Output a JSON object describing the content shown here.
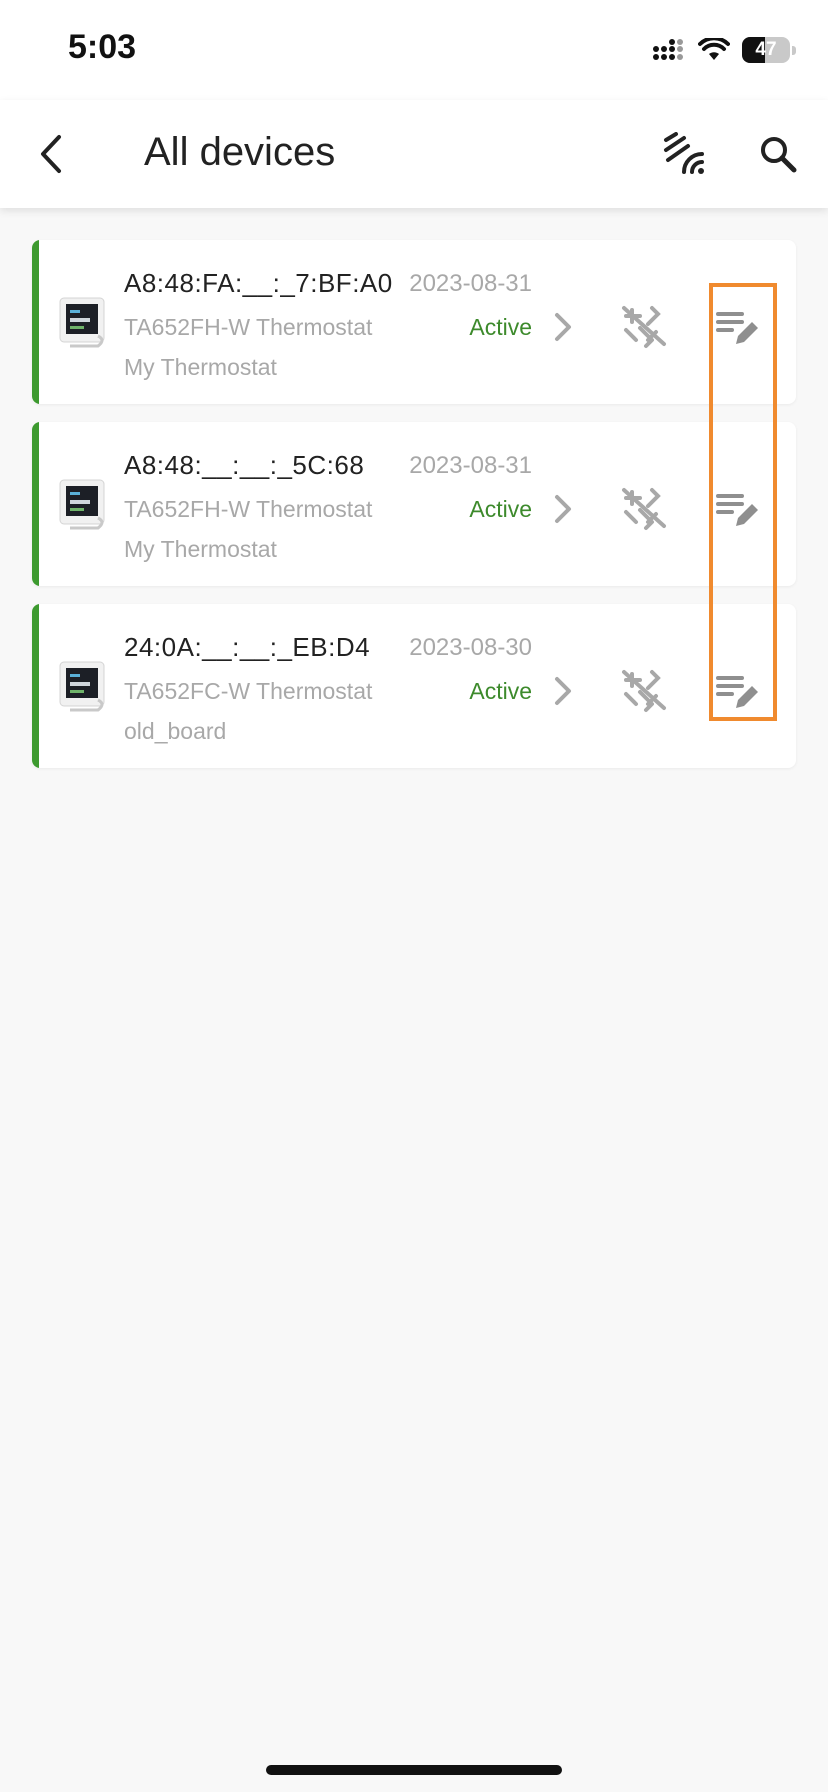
{
  "status_bar": {
    "time": "5:03",
    "battery_level": "47",
    "battery_fraction": 0.47
  },
  "app_bar": {
    "title": "All devices",
    "back_icon": "chevron-left-icon",
    "actions": [
      "nfc-signal-icon",
      "search-icon"
    ]
  },
  "devices": [
    {
      "mac": "A8:48:FA:__:_7:BF:A0",
      "date": "2023-08-31",
      "model": "TA652FH-W Thermostat",
      "status": "Active",
      "name": "My Thermostat"
    },
    {
      "mac": "A8:48:__:__:_5C:68",
      "date": "2023-08-31",
      "model": "TA652FH-W Thermostat",
      "status": "Active",
      "name": "My Thermostat"
    },
    {
      "mac": "24:0A:__:__:_EB:D4",
      "date": "2023-08-30",
      "model": "TA652FC-W Thermostat",
      "status": "Active",
      "name": "old_board"
    }
  ],
  "colors": {
    "accent_green": "#3d9a2f",
    "status_green": "#3d8a2c",
    "highlight_orange": "#f08a2e"
  }
}
